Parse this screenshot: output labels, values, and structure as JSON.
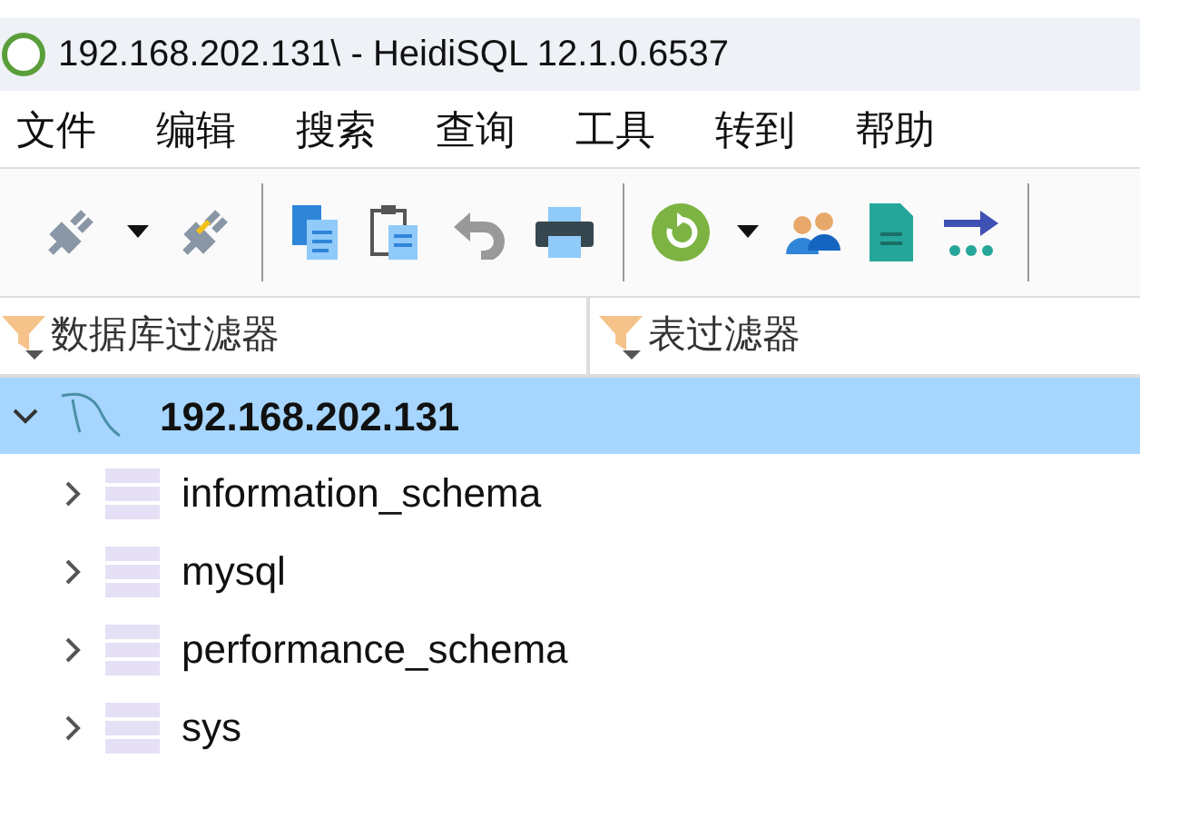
{
  "window": {
    "title": "192.168.202.131\\ - HeidiSQL 12.1.0.6537"
  },
  "menu": [
    "文件",
    "编辑",
    "搜索",
    "查询",
    "工具",
    "转到",
    "帮助"
  ],
  "filters": [
    {
      "placeholder": "数据库过滤器"
    },
    {
      "placeholder": "表过滤器"
    }
  ],
  "tree": [
    {
      "label": "192.168.202.131",
      "selected": true,
      "expanded": true,
      "children": [
        {
          "label": "information_schema",
          "selected": false,
          "expanded": false
        },
        {
          "label": "mysql",
          "selected": false,
          "expanded": false
        },
        {
          "label": "performance_schema",
          "selected": false,
          "expanded": false
        },
        {
          "label": "sys",
          "selected": false,
          "expanded": false
        }
      ]
    }
  ]
}
